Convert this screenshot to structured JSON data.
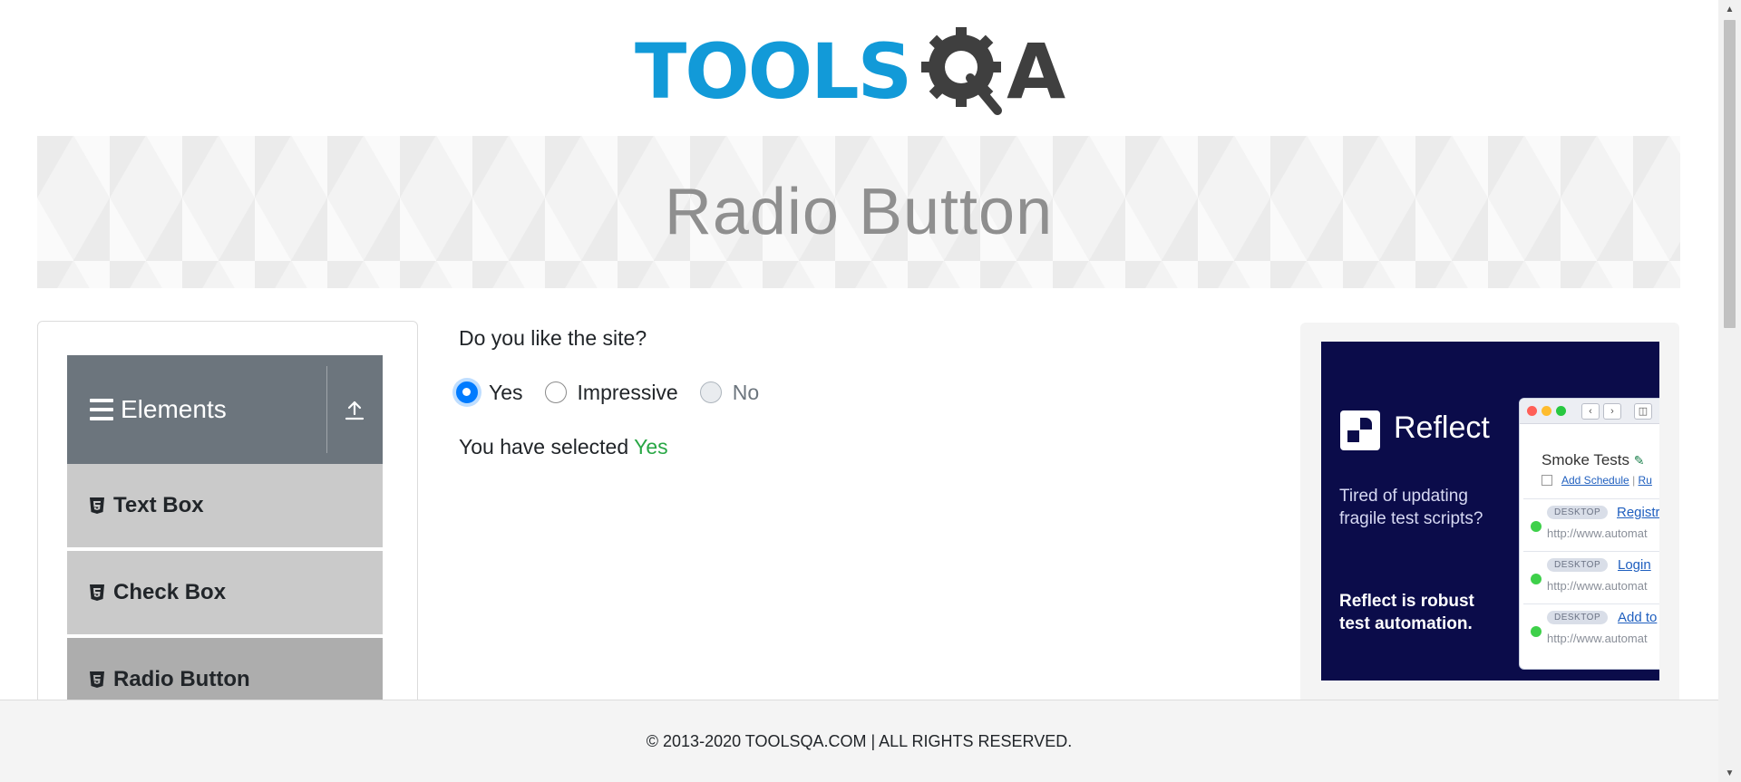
{
  "logo": {
    "text_main": "TOOLS",
    "text_end": "A",
    "q_icon": "gear-magnifier-icon"
  },
  "banner": {
    "title": "Radio Button"
  },
  "sidebar": {
    "group": {
      "label": "Elements",
      "icon": "hamburger-icon",
      "toggle_icon": "collapse-upload-icon"
    },
    "items": [
      {
        "label": "Text Box",
        "icon": "html5-icon",
        "active": false
      },
      {
        "label": "Check Box",
        "icon": "html5-icon",
        "active": false
      },
      {
        "label": "Radio Button",
        "icon": "html5-icon",
        "active": true
      }
    ]
  },
  "main": {
    "question": "Do you like the site?",
    "options": [
      {
        "label": "Yes",
        "checked": true,
        "disabled": false
      },
      {
        "label": "Impressive",
        "checked": false,
        "disabled": false
      },
      {
        "label": "No",
        "checked": false,
        "disabled": true
      }
    ],
    "result_prefix": "You have selected ",
    "result_value": "Yes"
  },
  "ad": {
    "brand": "Reflect",
    "tagline": "Tired of updating fragile test scripts?",
    "strong": "Reflect is robust test automation.",
    "window": {
      "title": "Smoke Tests",
      "add_schedule": "Add Schedule",
      "sep": "|",
      "run": "Ru",
      "rows": [
        {
          "badge": "DESKTOP",
          "link": "Registr",
          "url": "http://www.automat"
        },
        {
          "badge": "DESKTOP",
          "link": "Login",
          "url": "http://www.automat"
        },
        {
          "badge": "DESKTOP",
          "link": "Add to",
          "url": "http://www.automat"
        }
      ]
    },
    "colors": {
      "bg": "#0b0c4a",
      "green": "#3ed04a"
    }
  },
  "footer": {
    "text": "© 2013-2020 TOOLSQA.COM | ALL RIGHTS RESERVED."
  },
  "colors": {
    "accent": "#007bff",
    "success": "#28a745",
    "logo_blue": "#129ad8",
    "nav_header": "#6c757d"
  }
}
